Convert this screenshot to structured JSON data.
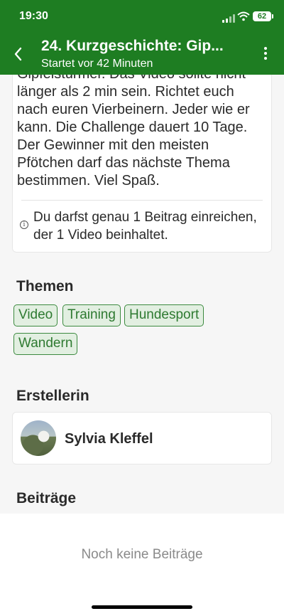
{
  "status_bar": {
    "time": "19:30",
    "battery": "62"
  },
  "nav": {
    "title": "24. Kurzgeschichte: Gip...",
    "subtitle": "Startet vor 42 Minuten"
  },
  "description": {
    "lines": [
      "Gipfelstürmer. Das Video sollte nicht",
      "länger als 2 min sein. Richtet euch",
      "nach euren Vierbeinern. Jeder wie er",
      "kann. Die Challenge dauert 10 Tage.",
      "Der Gewinner mit den meisten",
      "Pfötchen darf das nächste Thema",
      "bestimmen. Viel Spaß."
    ],
    "info": "Du darfst genau 1 Beitrag einreichen, der 1 Video beinhaltet."
  },
  "themes": {
    "title": "Themen",
    "tags": [
      "Video",
      "Training",
      "Hundesport",
      "Wandern"
    ]
  },
  "creator": {
    "title": "Erstellerin",
    "name": "Sylvia Kleffel"
  },
  "contributions": {
    "title": "Beiträge",
    "empty": "Noch keine Beiträge"
  }
}
